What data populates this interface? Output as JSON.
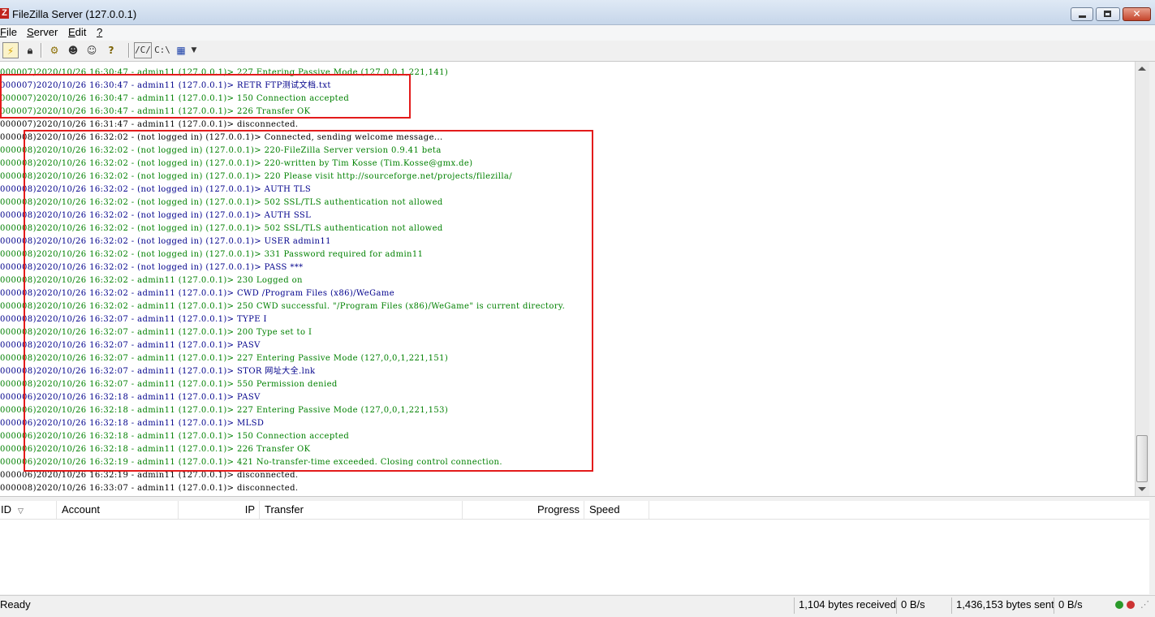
{
  "window": {
    "title": "FileZilla Server (127.0.0.1)",
    "app_icon": "Z"
  },
  "menu": [
    {
      "u": "F",
      "rest": "ile"
    },
    {
      "u": "S",
      "rest": "erver"
    },
    {
      "u": "E",
      "rest": "dit"
    },
    {
      "u": "?",
      "rest": ""
    }
  ],
  "toolbar": {
    "icons": [
      "connect-icon",
      "lock-icon",
      "settings-icon",
      "users-icon",
      "groups-icon",
      "help-icon",
      "path-view-icon",
      "drive-view-icon",
      "calendar-icon",
      "dropdown-icon"
    ],
    "path_c_label": "/C/",
    "drive_c_label": "C:\\"
  },
  "log_colors": {
    "command": "#00008b",
    "response": "#008000",
    "info": "#000000"
  },
  "log": [
    {
      "type": "response",
      "text": "000007)2020/10/26 16:30:47 - admin11 (127.0.0.1)> 227 Entering Passive Mode (127,0,0,1,221,141)"
    },
    {
      "type": "command",
      "text": "000007)2020/10/26 16:30:47 - admin11 (127.0.0.1)> RETR FTP测试文档.txt"
    },
    {
      "type": "response",
      "text": "000007)2020/10/26 16:30:47 - admin11 (127.0.0.1)> 150 Connection accepted"
    },
    {
      "type": "response",
      "text": "000007)2020/10/26 16:30:47 - admin11 (127.0.0.1)> 226 Transfer OK"
    },
    {
      "type": "info",
      "text": "000007)2020/10/26 16:31:47 - admin11 (127.0.0.1)> disconnected."
    },
    {
      "type": "info",
      "text": "000008)2020/10/26 16:32:02 - (not logged in) (127.0.0.1)> Connected, sending welcome message..."
    },
    {
      "type": "response",
      "text": "000008)2020/10/26 16:32:02 - (not logged in) (127.0.0.1)> 220-FileZilla Server version 0.9.41 beta"
    },
    {
      "type": "response",
      "text": "000008)2020/10/26 16:32:02 - (not logged in) (127.0.0.1)> 220-written by Tim Kosse (Tim.Kosse@gmx.de)"
    },
    {
      "type": "response",
      "text": "000008)2020/10/26 16:32:02 - (not logged in) (127.0.0.1)> 220 Please visit http://sourceforge.net/projects/filezilla/"
    },
    {
      "type": "command",
      "text": "000008)2020/10/26 16:32:02 - (not logged in) (127.0.0.1)> AUTH TLS"
    },
    {
      "type": "response",
      "text": "000008)2020/10/26 16:32:02 - (not logged in) (127.0.0.1)> 502 SSL/TLS authentication not allowed"
    },
    {
      "type": "command",
      "text": "000008)2020/10/26 16:32:02 - (not logged in) (127.0.0.1)> AUTH SSL"
    },
    {
      "type": "response",
      "text": "000008)2020/10/26 16:32:02 - (not logged in) (127.0.0.1)> 502 SSL/TLS authentication not allowed"
    },
    {
      "type": "command",
      "text": "000008)2020/10/26 16:32:02 - (not logged in) (127.0.0.1)> USER admin11"
    },
    {
      "type": "response",
      "text": "000008)2020/10/26 16:32:02 - (not logged in) (127.0.0.1)> 331 Password required for admin11"
    },
    {
      "type": "command",
      "text": "000008)2020/10/26 16:32:02 - (not logged in) (127.0.0.1)> PASS ***"
    },
    {
      "type": "response",
      "text": "000008)2020/10/26 16:32:02 - admin11 (127.0.0.1)> 230 Logged on"
    },
    {
      "type": "command",
      "text": "000008)2020/10/26 16:32:02 - admin11 (127.0.0.1)> CWD /Program Files (x86)/WeGame"
    },
    {
      "type": "response",
      "text": "000008)2020/10/26 16:32:02 - admin11 (127.0.0.1)> 250 CWD successful. \"/Program Files (x86)/WeGame\" is current directory."
    },
    {
      "type": "command",
      "text": "000008)2020/10/26 16:32:07 - admin11 (127.0.0.1)> TYPE I"
    },
    {
      "type": "response",
      "text": "000008)2020/10/26 16:32:07 - admin11 (127.0.0.1)> 200 Type set to I"
    },
    {
      "type": "command",
      "text": "000008)2020/10/26 16:32:07 - admin11 (127.0.0.1)> PASV"
    },
    {
      "type": "response",
      "text": "000008)2020/10/26 16:32:07 - admin11 (127.0.0.1)> 227 Entering Passive Mode (127,0,0,1,221,151)"
    },
    {
      "type": "command",
      "text": "000008)2020/10/26 16:32:07 - admin11 (127.0.0.1)> STOR 网址大全.lnk"
    },
    {
      "type": "response",
      "text": "000008)2020/10/26 16:32:07 - admin11 (127.0.0.1)> 550 Permission denied"
    },
    {
      "type": "command",
      "text": "000006)2020/10/26 16:32:18 - admin11 (127.0.0.1)> PASV"
    },
    {
      "type": "response",
      "text": "000006)2020/10/26 16:32:18 - admin11 (127.0.0.1)> 227 Entering Passive Mode (127,0,0,1,221,153)"
    },
    {
      "type": "command",
      "text": "000006)2020/10/26 16:32:18 - admin11 (127.0.0.1)> MLSD"
    },
    {
      "type": "response",
      "text": "000006)2020/10/26 16:32:18 - admin11 (127.0.0.1)> 150 Connection accepted"
    },
    {
      "type": "response",
      "text": "000006)2020/10/26 16:32:18 - admin11 (127.0.0.1)> 226 Transfer OK"
    },
    {
      "type": "response",
      "text": "000006)2020/10/26 16:32:19 - admin11 (127.0.0.1)> 421 No-transfer-time exceeded. Closing control connection."
    },
    {
      "type": "info",
      "text": "000006)2020/10/26 16:32:19 - admin11 (127.0.0.1)> disconnected."
    },
    {
      "type": "info",
      "text": "000008)2020/10/26 16:33:07 - admin11 (127.0.0.1)> disconnected."
    }
  ],
  "sessions": {
    "columns": {
      "id": "ID",
      "account": "Account",
      "ip": "IP",
      "transfer": "Transfer",
      "progress": "Progress",
      "speed": "Speed"
    },
    "sort_icon": "sort-down-icon"
  },
  "status": {
    "ready": "Ready",
    "received": "1,104 bytes received",
    "recv_speed": "0 B/s",
    "sent": "1,436,153 bytes sent",
    "sent_speed": "0 B/s"
  }
}
